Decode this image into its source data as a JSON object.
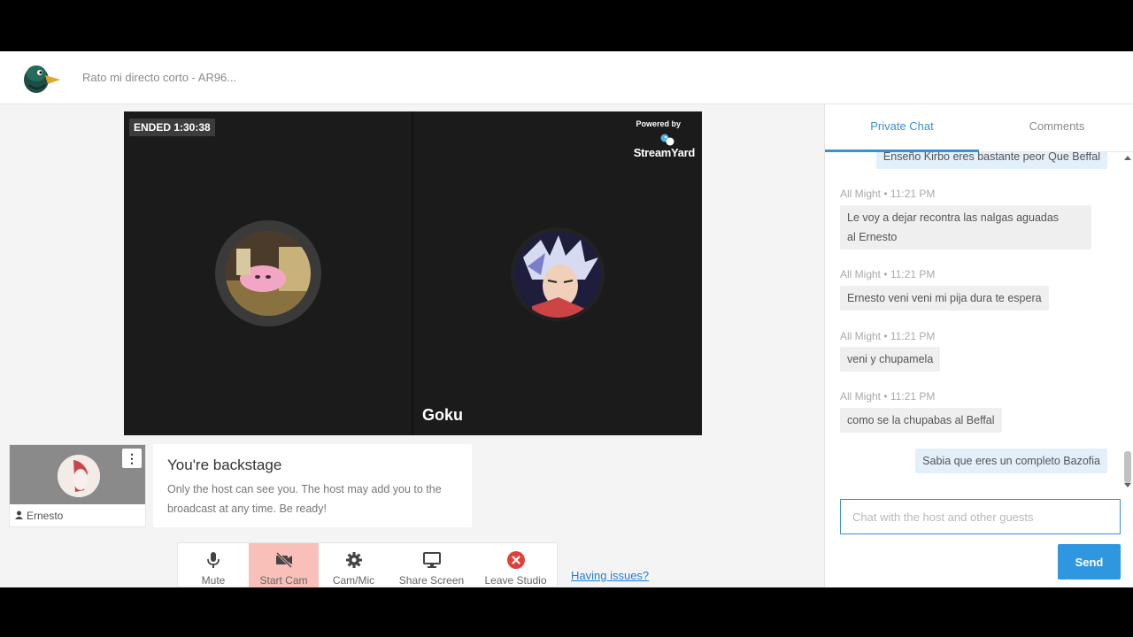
{
  "header": {
    "broadcast_title": "Rato mi directo corto - AR96..."
  },
  "stage": {
    "ended_badge": "ENDED 1:30:38",
    "powered_by": "Powered by",
    "brand": "StreamYard",
    "guest_name": "Goku"
  },
  "backstage": {
    "participant_name": "Ernesto",
    "title": "You're backstage",
    "description": "Only the host can see you. The host may add you to the broadcast at any time. Be ready!"
  },
  "controls": {
    "mute": "Mute",
    "start_cam": "Start Cam",
    "cam_mic": "Cam/Mic",
    "share_screen": "Share Screen",
    "leave_studio": "Leave Studio",
    "having_issues": "Having issues?"
  },
  "chat": {
    "tabs": [
      "Private Chat",
      "Comments"
    ],
    "partial_message": "Enseño Kirbo eres bastante peor Que Beffal",
    "messages": [
      {
        "author": "All Might",
        "time": "11:21 PM",
        "text_lines": [
          "Le voy a dejar recontra las nalgas aguadas",
          "al Ernesto"
        ]
      },
      {
        "author": "All Might",
        "time": "11:21 PM",
        "text_lines": [
          "Ernesto veni veni mi pija dura te espera"
        ]
      },
      {
        "author": "All Might",
        "time": "11:21 PM",
        "text_lines": [
          "veni y chupamela"
        ]
      },
      {
        "author": "All Might",
        "time": "11:21 PM",
        "text_lines": [
          "como se la chupabas al Beffal"
        ]
      }
    ],
    "own_message": "Sabia que eres un completo Bazofia",
    "meta_separator": "•",
    "input_placeholder": "Chat with the host and other guests",
    "send_label": "Send"
  },
  "colors": {
    "accent": "#2e97e0",
    "start_cam_active": "#f8c0b8",
    "leave_icon": "#e0413a"
  }
}
